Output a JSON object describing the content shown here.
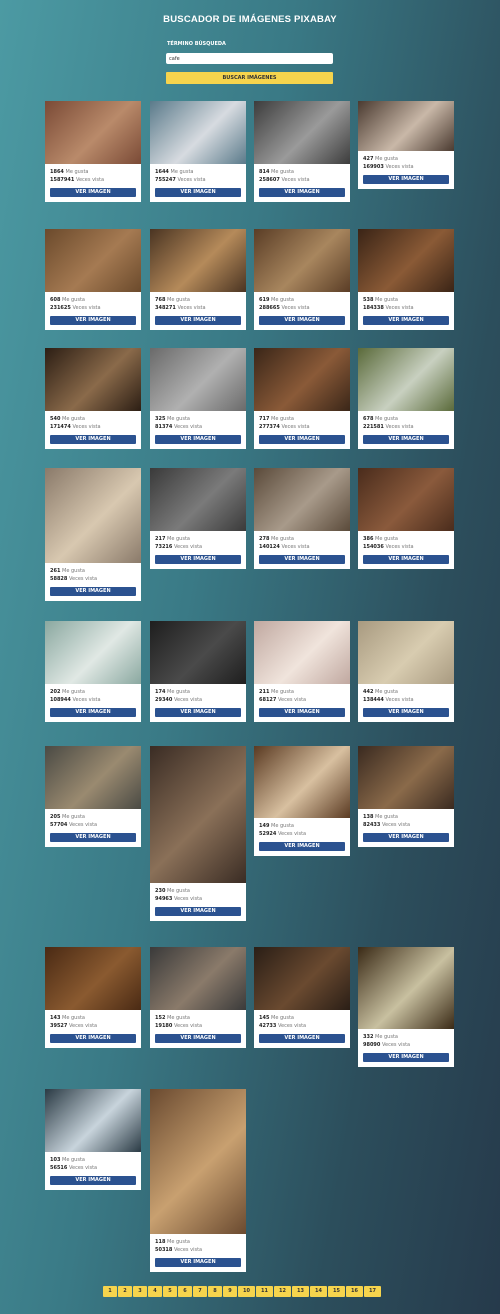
{
  "app": {
    "title": "BUSCADOR DE IMÁGENES PIXABAY",
    "search_label": "TÉRMINO BÚSQUEDA",
    "search_value": "cafe",
    "search_button": "BUSCAR IMÁGENES"
  },
  "card_labels": {
    "likes": "Me gusta",
    "views": "Veces vista",
    "button": "VER IMAGEN"
  },
  "images": [
    {
      "likes": "1864",
      "views": "1587941"
    },
    {
      "likes": "1644",
      "views": "755247"
    },
    {
      "likes": "814",
      "views": "258607"
    },
    {
      "likes": "427",
      "views": "169903"
    },
    {
      "likes": "608",
      "views": "231625"
    },
    {
      "likes": "768",
      "views": "348271"
    },
    {
      "likes": "619",
      "views": "288665"
    },
    {
      "likes": "538",
      "views": "184338"
    },
    {
      "likes": "540",
      "views": "171474"
    },
    {
      "likes": "325",
      "views": "81374"
    },
    {
      "likes": "717",
      "views": "277374"
    },
    {
      "likes": "678",
      "views": "221581"
    },
    {
      "likes": "261",
      "views": "58828"
    },
    {
      "likes": "217",
      "views": "73216"
    },
    {
      "likes": "278",
      "views": "140124"
    },
    {
      "likes": "386",
      "views": "154036"
    },
    {
      "likes": "202",
      "views": "108944"
    },
    {
      "likes": "174",
      "views": "29340"
    },
    {
      "likes": "211",
      "views": "68127"
    },
    {
      "likes": "442",
      "views": "138444"
    },
    {
      "likes": "205",
      "views": "57704"
    },
    {
      "likes": "230",
      "views": "94963"
    },
    {
      "likes": "149",
      "views": "52924"
    },
    {
      "likes": "138",
      "views": "82433"
    },
    {
      "likes": "143",
      "views": "39527"
    },
    {
      "likes": "152",
      "views": "19180"
    },
    {
      "likes": "145",
      "views": "42733"
    },
    {
      "likes": "332",
      "views": "98090"
    },
    {
      "likes": "103",
      "views": "56516"
    },
    {
      "likes": "118",
      "views": "50318"
    }
  ],
  "pages": [
    "1",
    "2",
    "3",
    "4",
    "5",
    "6",
    "7",
    "8",
    "9",
    "10",
    "11",
    "12",
    "13",
    "14",
    "15",
    "16",
    "17"
  ],
  "colors": {
    "accent": "#f6d44d",
    "button": "#2b5290"
  }
}
